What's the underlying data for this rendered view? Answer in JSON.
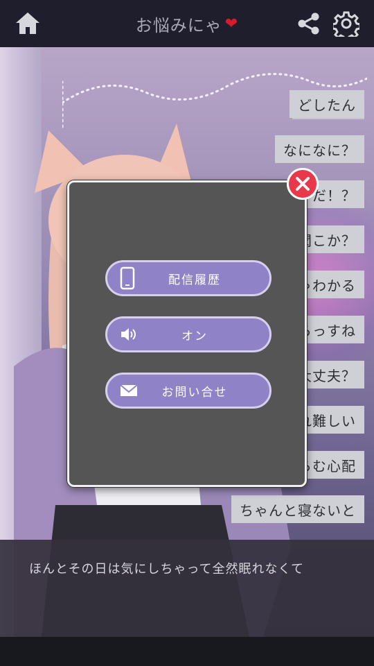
{
  "header": {
    "title": "お悩みにゃ",
    "title_heart": "❤"
  },
  "options": [
    {
      "label": "どしたん"
    },
    {
      "label": "なになに？"
    },
    {
      "label": "だ！？"
    },
    {
      "label": "聞こか？"
    },
    {
      "label": "ゃわかる"
    },
    {
      "label": "らっすね"
    },
    {
      "label": "大丈夫？"
    },
    {
      "label": "れ難しい"
    },
    {
      "label": "らむ心配"
    },
    {
      "label": "ちゃんと寝ないと"
    }
  ],
  "message": {
    "text": "ほんとその日は気にしちゃって全然眠れなくて"
  },
  "modal": {
    "buttons": [
      {
        "label": "配信履歴",
        "icon": "smartphone-icon"
      },
      {
        "label": "オン",
        "icon": "speaker-icon"
      },
      {
        "label": "お問い合せ",
        "icon": "envelope-icon"
      }
    ]
  },
  "colors": {
    "header_bg": "#1e1e2c",
    "modal_bg": "#555556",
    "menu_button": "#8f82c6",
    "close_button": "#e8384a",
    "heart": "#d81a2a"
  }
}
